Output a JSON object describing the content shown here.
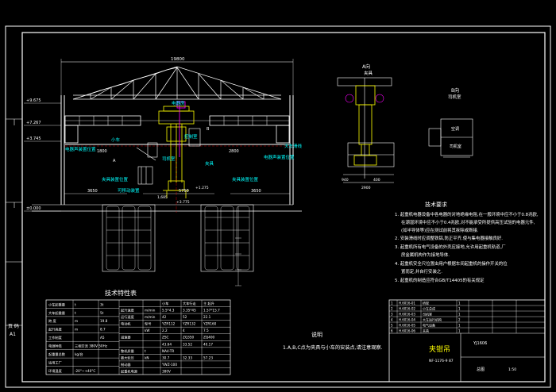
{
  "colors": {
    "background": "#000000",
    "frame": "#ffffff",
    "structure": "#ffff00",
    "annotation": "#00ffff",
    "dimension": "#00ff00",
    "accent": "#ff00ff",
    "hidden": "#ff0000"
  },
  "elevation": {
    "span_dim": "19800",
    "levels_left": [
      "+9.675",
      "+7.267",
      "+3.745",
      "±0.000"
    ],
    "level_bottom": "±0.000",
    "labels": {
      "electrical_room": "电器房",
      "cabin": "司机室",
      "control_room": "控制室",
      "trolley": "小车",
      "clamp": "夹具",
      "power_line": "天车滑线",
      "sound_pos_left": "电器声装置位置",
      "sound_pos_right": "电器声装置位置",
      "clamp_pos_left": "夹具装置位置",
      "clamp_pos_right": "夹具装置位置",
      "shift_pos": "可移动装置",
      "mark_a": "A",
      "mark_b": "B"
    },
    "dims": {
      "d1": "1800",
      "d2": "2800",
      "d3": "3650",
      "d4": "3650",
      "d5": "5750",
      "d6": "2800",
      "d7": "1,685",
      "d8": "+3.775",
      "d9": "+0.900",
      "d10": "+1.275"
    }
  },
  "side_view": {
    "title": "A向",
    "subtitle": "夹具",
    "dim_bottom": "2900",
    "dims_small": [
      "940",
      "400"
    ]
  },
  "cabin_view": {
    "title": "B向",
    "subtitle": "司机室",
    "labels": [
      "空调",
      "司机室"
    ]
  },
  "requirements": {
    "title": "技术要求",
    "items": [
      "1. 起重机电器设备中各电器的对地绝缘电阻,在一般环境中应不小于0.8兆欧,",
      "在潮湿环境中应不小于0.4兆欧,对不能承受所提供高压试验的电器元件,",
      "(如半导体等)应在测试前将其拆除或断接.",
      "2. 安装滑线时应调整铁铝,防正平齐,使与集电器接触良好.",
      "3. 起重机所有电气设备的外壳应接地,允许用起重机轨道,厂",
      "房金属机构作为接地导体.",
      "4. 起重机安全尺位置由用户根据车间起重机的操作开关的位",
      "置而定,并自行安装之.",
      "5. 起重机的制造应符合GB/T14405的有关规定"
    ]
  },
  "spec_table": {
    "title": "技术特性表",
    "left_rows": [
      [
        "小车起重量",
        "t",
        "3t"
      ],
      [
        "大车起重量",
        "t",
        "5t"
      ],
      [
        "跨 度",
        "m",
        "19.8"
      ],
      [
        "起升高度",
        "m",
        "8.7"
      ],
      [
        "工作制度",
        "",
        "A5"
      ],
      [
        "电源种类",
        "三相交流 380V 50Hz",
        ""
      ],
      [
        "起重量总数",
        "kg/台",
        ""
      ],
      [
        "适用工厂",
        "",
        ""
      ],
      [
        "环境温度",
        "-20°~+40°C",
        ""
      ]
    ],
    "right_head": [
      "",
      "",
      "小车",
      "大车行走",
      "主 起升"
    ],
    "right_rows": [
      [
        "起升速度",
        "m/min",
        "5.5*4.3",
        "3.35*45",
        "1.57*15.7"
      ],
      [
        "运行速度",
        "m/min",
        "42",
        "52",
        "22.1"
      ],
      [
        "电动机",
        "型号",
        "YZR112",
        "YZR132",
        "YZR160"
      ],
      [
        "",
        "kW",
        "2.2",
        "4",
        "7.5"
      ],
      [
        "减速器",
        "",
        "ZSC",
        "ZQ350",
        "ZQ400"
      ],
      [
        "",
        "",
        "43.64",
        "33.52",
        "40.17"
      ],
      [
        "整机质量",
        "t",
        "NA4-TR",
        "",
        ""
      ],
      [
        "最大轮压",
        "kN",
        "30.7",
        "32.33",
        "57.23"
      ],
      [
        "制动器",
        "",
        "YWZ-100",
        "",
        ""
      ],
      [
        "起重机电源",
        "",
        "380V",
        "",
        ""
      ]
    ],
    "side_labels": [
      "页 码",
      "A1"
    ]
  },
  "note": {
    "title": "说明",
    "text": "1.A,B,C点为夹具与小车的安装点,请注意观察."
  },
  "title_block": {
    "name": "夹钳吊",
    "code": "YJ1606",
    "scale": "1:50",
    "sheet": "NF-1176-9 87",
    "unit": "总图",
    "rows": [
      [
        "1",
        "H.6016-01",
        "桥架",
        "1",
        "",
        "",
        ""
      ],
      [
        "2",
        "H.6016-02",
        "小车总成",
        "1",
        "",
        "",
        ""
      ],
      [
        "3",
        "H.6016-03",
        "司机室",
        "1",
        "",
        "",
        ""
      ],
      [
        "4",
        "H.6016-04",
        "大车运行机构",
        "2",
        "",
        "",
        ""
      ],
      [
        "5",
        "H.6016-05",
        "电气设备",
        "1",
        "",
        "",
        ""
      ],
      [
        "6",
        "H.6016-06",
        "夹具",
        "1",
        "",
        "",
        ""
      ]
    ]
  }
}
